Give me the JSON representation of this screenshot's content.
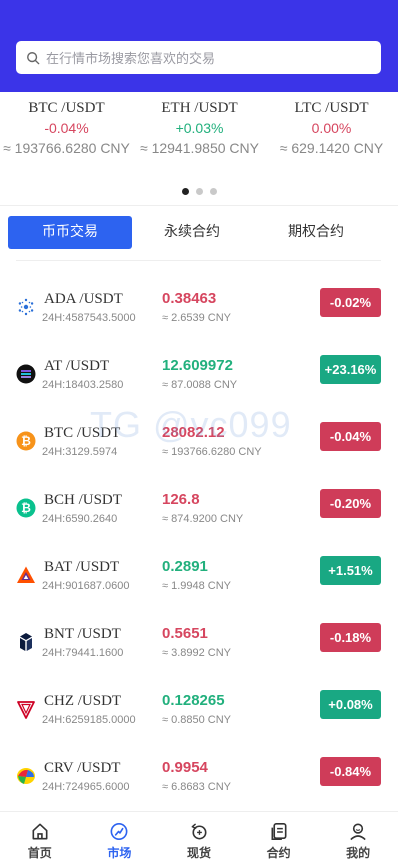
{
  "search": {
    "placeholder": "在行情市场搜索您喜欢的交易"
  },
  "ticker": [
    {
      "pair": "BTC /USDT",
      "change": "-0.04%",
      "dir": "down",
      "cny": "≈ 193766.6280 CNY"
    },
    {
      "pair": "ETH /USDT",
      "change": "+0.03%",
      "dir": "up",
      "cny": "≈ 12941.9850 CNY"
    },
    {
      "pair": "LTC /USDT",
      "change": "0.00%",
      "dir": "down",
      "cny": "≈ 629.1420 CNY"
    }
  ],
  "carousel": {
    "count": 3,
    "active": 0
  },
  "tabs": [
    {
      "label": "币币交易",
      "active": true
    },
    {
      "label": "永续合约",
      "active": false
    },
    {
      "label": "期权合约",
      "active": false
    }
  ],
  "watermark": "TG @vc099",
  "markets": [
    {
      "pair": "ADA /USDT",
      "icon": "cardano-icon",
      "vol": "24H:4587543.5000",
      "price": "0.38463",
      "cny": "≈ 2.6539 CNY",
      "change": "-0.02%",
      "dir": "down"
    },
    {
      "pair": "AT /USDT",
      "icon": "at-icon",
      "vol": "24H:18403.2580",
      "price": "12.609972",
      "cny": "≈ 87.0088 CNY",
      "change": "+23.16%",
      "dir": "up"
    },
    {
      "pair": "BTC /USDT",
      "icon": "bitcoin-icon",
      "vol": "24H:3129.5974",
      "price": "28082.12",
      "cny": "≈ 193766.6280 CNY",
      "change": "-0.04%",
      "dir": "down"
    },
    {
      "pair": "BCH /USDT",
      "icon": "bitcoin-cash-icon",
      "vol": "24H:6590.2640",
      "price": "126.8",
      "cny": "≈ 874.9200 CNY",
      "change": "-0.20%",
      "dir": "down"
    },
    {
      "pair": "BAT /USDT",
      "icon": "bat-icon",
      "vol": "24H:901687.0600",
      "price": "0.2891",
      "cny": "≈ 1.9948 CNY",
      "change": "+1.51%",
      "dir": "up"
    },
    {
      "pair": "BNT /USDT",
      "icon": "bancor-icon",
      "vol": "24H:79441.1600",
      "price": "0.5651",
      "cny": "≈ 3.8992 CNY",
      "change": "-0.18%",
      "dir": "down"
    },
    {
      "pair": "CHZ /USDT",
      "icon": "chiliz-icon",
      "vol": "24H:6259185.0000",
      "price": "0.128265",
      "cny": "≈ 0.8850 CNY",
      "change": "+0.08%",
      "dir": "up"
    },
    {
      "pair": "CRV /USDT",
      "icon": "curve-icon",
      "vol": "24H:724965.6000",
      "price": "0.9954",
      "cny": "≈ 6.8683 CNY",
      "change": "-0.84%",
      "dir": "down"
    }
  ],
  "nav": [
    {
      "label": "首页",
      "icon": "home-icon",
      "active": false
    },
    {
      "label": "市场",
      "icon": "market-icon",
      "active": true
    },
    {
      "label": "现货",
      "icon": "spot-icon",
      "active": false
    },
    {
      "label": "合约",
      "icon": "contract-icon",
      "active": false
    },
    {
      "label": "我的",
      "icon": "profile-icon",
      "active": false
    }
  ],
  "colors": {
    "header": "#3b34e8",
    "accent": "#2d63f0",
    "down": "#cf3c59",
    "up": "#19a883"
  }
}
